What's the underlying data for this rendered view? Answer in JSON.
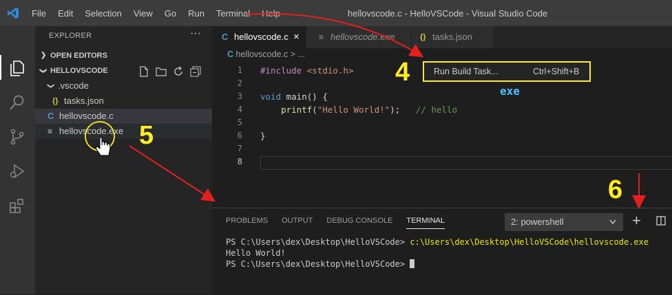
{
  "titlebar": {
    "menu": [
      "File",
      "Edit",
      "Selection",
      "View",
      "Go",
      "Run",
      "Terminal",
      "Help"
    ],
    "window_title": "hellovscode.c - HelloVSCode - Visual Studio Code"
  },
  "sidebar": {
    "title": "EXPLORER",
    "more": "···",
    "open_editors": "OPEN EDITORS",
    "project": "HELLOVSCODE",
    "folder": ".vscode",
    "file_tasks": "tasks.json",
    "file_c": "hellovscode.c",
    "file_exe": "hellovscode.exe",
    "tasks_icon_text": "{}",
    "c_icon_text": "C"
  },
  "tabs": [
    {
      "label": "hellovscode.c",
      "icon": "C"
    },
    {
      "label": "hellovscode.exe",
      "icon": "≡"
    },
    {
      "label": "tasks.json",
      "icon": "{}"
    }
  ],
  "close_glyph": "×",
  "breadcrumb": {
    "file": "hellovscode.c",
    "sep": ">",
    "rest": "..."
  },
  "code": {
    "line_numbers": [
      "1",
      "2",
      "3",
      "4",
      "5",
      "6",
      "7",
      "8"
    ],
    "l1_directive": "#include",
    "l1_header": "<stdio.h>",
    "l3_type": "void",
    "l3_rest": " main() {",
    "l4_indent": "    ",
    "l4_fn": "printf",
    "l4_open": "(",
    "l4_str": "\"Hello World!\"",
    "l4_close": ");",
    "l4_comment": "   // hello",
    "l6": "}"
  },
  "popup": {
    "label": "Run Build Task...",
    "shortcut": "Ctrl+Shift+B"
  },
  "exe_annotation": "exe",
  "annotations": [
    "4",
    "5",
    "6"
  ],
  "panel": {
    "tabs": [
      "PROBLEMS",
      "OUTPUT",
      "DEBUG CONSOLE",
      "TERMINAL"
    ],
    "terminal_select": "2: powershell",
    "add_glyph": "+",
    "terminal": {
      "prompt1": "PS C:\\Users\\dex\\Desktop\\HelloVSCode> ",
      "cmd1": "c:\\Users\\dex\\Desktop\\HelloVSCode\\hellovscode.exe",
      "out1": "Hello World!",
      "prompt2": "PS C:\\Users\\dex\\Desktop\\HelloVSCode> "
    }
  },
  "colors": {
    "annotation": "#ffee22",
    "arrow": "#e32020",
    "exe_text": "#4fc1ff",
    "keyword": "#569cd6",
    "directive": "#c586c0",
    "string": "#ce9178",
    "function": "#dcdcaa",
    "comment": "#6a9955",
    "terminal_cmd": "#e5e510"
  }
}
